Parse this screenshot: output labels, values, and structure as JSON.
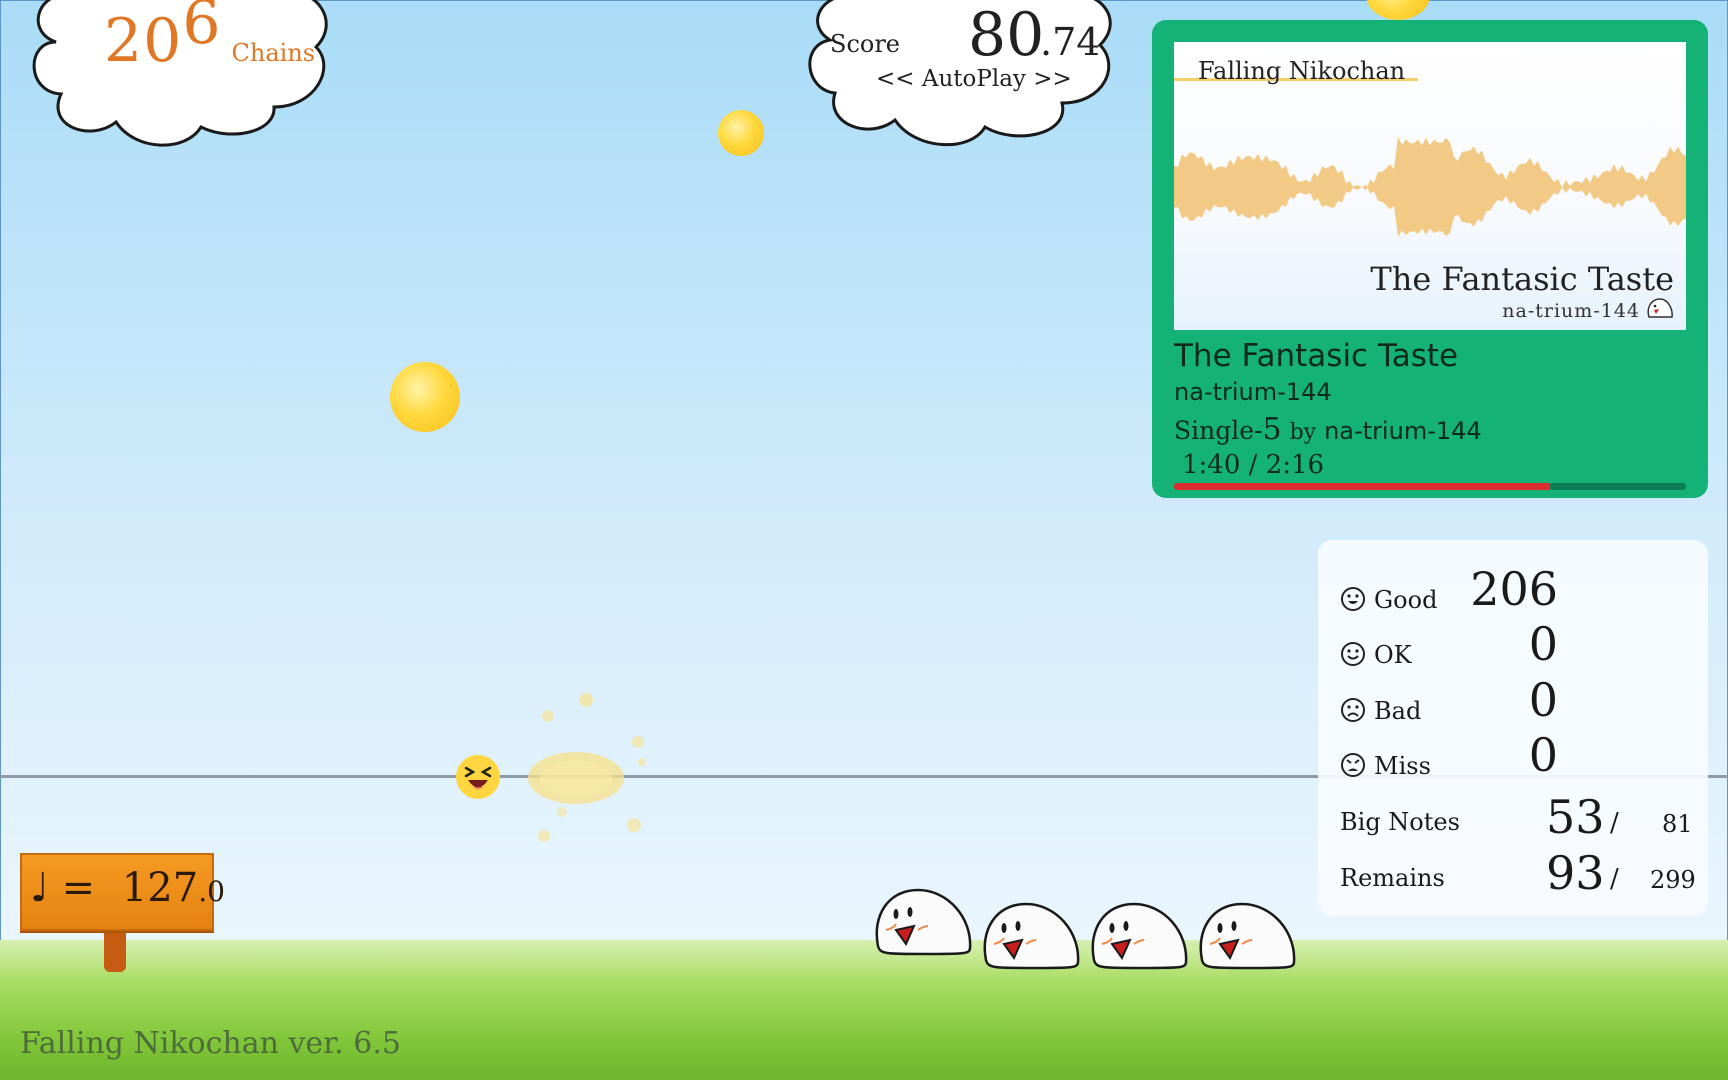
{
  "hud": {
    "chains_base": "20",
    "chains_last_digit": "6",
    "chains_label": "Chains",
    "score_label": "Score",
    "score_int": "80",
    "score_dec": ".74",
    "mode": "<< AutoPlay >>"
  },
  "song": {
    "jacket_title": "Falling Nikochan",
    "jacket_song": "The Fantasic Taste",
    "jacket_artist": "na-trium-144",
    "title": "The Fantasic Taste",
    "artist": "na-trium-144",
    "level_name": "Single-",
    "level_num": "5",
    "by": "by",
    "chart_author": "na-trium-144",
    "time": "1:40 / 2:16",
    "progress": 0.735
  },
  "stats": {
    "good_label": "Good",
    "good_value": "206",
    "ok_label": "OK",
    "ok_value": "0",
    "bad_label": "Bad",
    "bad_value": "0",
    "miss_label": "Miss",
    "miss_value": "0",
    "bignotes_label": "Big Notes",
    "bignotes_value": "53",
    "bignotes_slash": "/",
    "bignotes_total": "81",
    "remains_label": "Remains",
    "remains_value": "93",
    "remains_slash": "/",
    "remains_total": "299"
  },
  "tempo": {
    "symbol": "♩",
    "eq": "=",
    "int": "127",
    "dec": ".0"
  },
  "footer": {
    "version": "Falling Nikochan  ver. 6.5"
  },
  "colors": {
    "panel": "#14b277",
    "chains": "#e07724",
    "progress": "#dc2e2e",
    "sign": "#f59a23"
  }
}
